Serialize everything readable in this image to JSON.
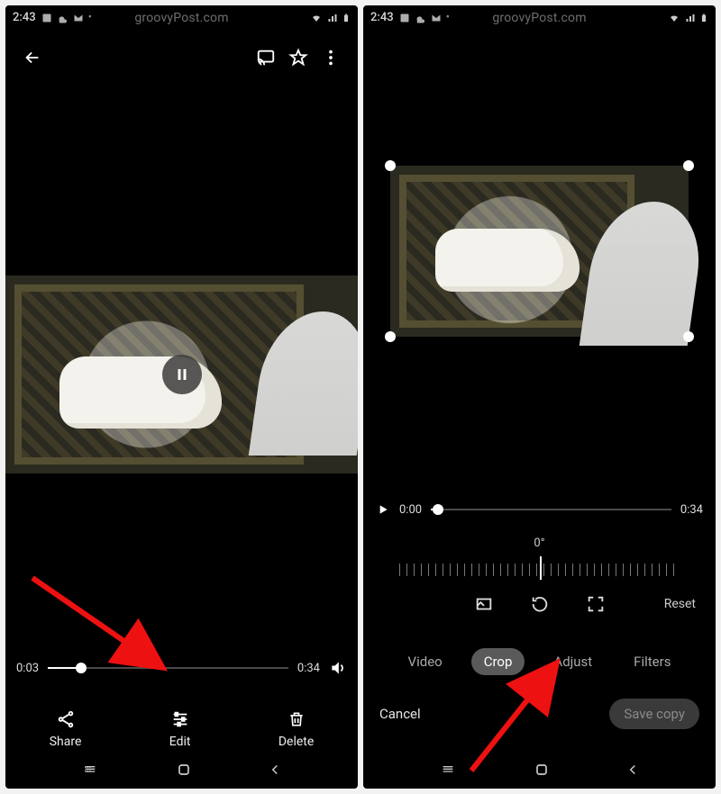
{
  "statusbar": {
    "time": "2:43",
    "watermark": "groovyPost.com"
  },
  "left": {
    "seek": {
      "current": "0:03",
      "duration": "0:34",
      "progress_pct": 14
    },
    "actions": {
      "share": "Share",
      "edit": "Edit",
      "delete": "Delete"
    }
  },
  "right": {
    "seek": {
      "current": "0:00",
      "duration": "0:34",
      "progress_pct": 3
    },
    "rotation_label": "0°",
    "reset_label": "Reset",
    "tabs": {
      "video": "Video",
      "crop": "Crop",
      "adjust": "Adjust",
      "filters": "Filters"
    },
    "bottombar": {
      "cancel": "Cancel",
      "save": "Save copy"
    }
  }
}
